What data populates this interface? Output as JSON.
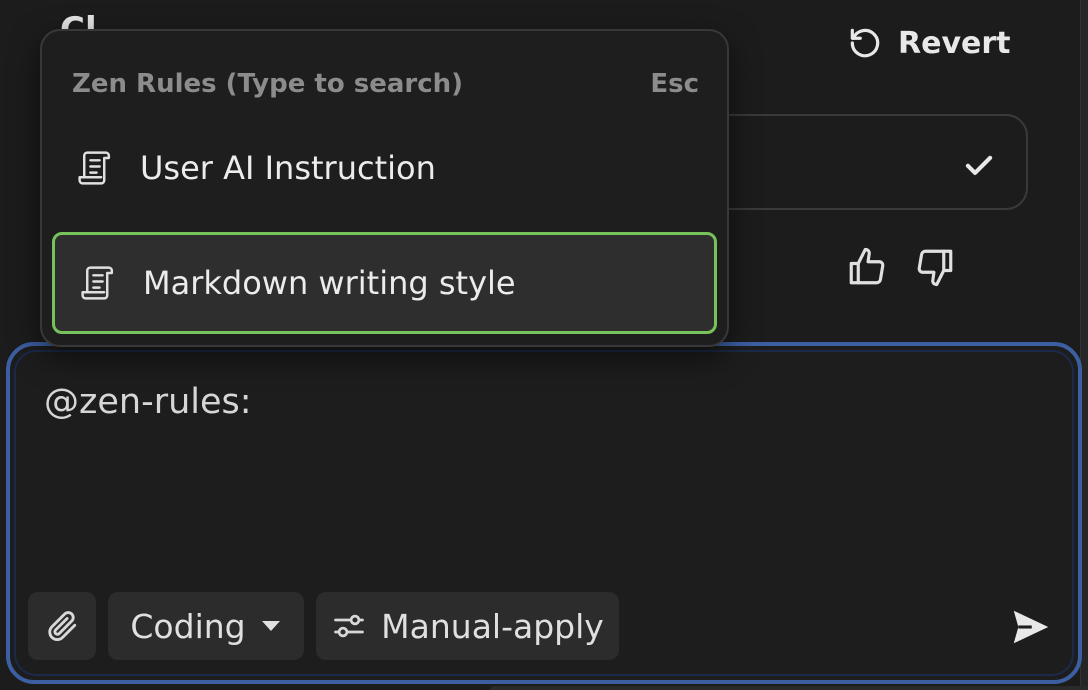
{
  "background_heading": "Cl",
  "header": {
    "revert_label": "Revert",
    "revert_icon": "undo-icon"
  },
  "background_field": {
    "confirm_icon": "check-icon"
  },
  "feedback": {
    "like_icon": "thumbs-up-icon",
    "dislike_icon": "thumbs-down-icon"
  },
  "rules_dropdown": {
    "header": "Zen Rules (Type to search)",
    "dismiss_hint": "Esc",
    "items": [
      {
        "label": "User AI Instruction",
        "icon": "scroll-icon",
        "selected": false
      },
      {
        "label": "Markdown writing style",
        "icon": "scroll-icon",
        "selected": true
      }
    ]
  },
  "composer": {
    "value": "@zen-rules:",
    "attach_icon": "paperclip-icon",
    "mode": {
      "label": "Coding",
      "icon": "caret-down-icon"
    },
    "apply": {
      "label": "Manual-apply",
      "icon": "sliders-icon"
    },
    "send_icon": "send-icon"
  },
  "colors": {
    "background": "#1c1c1c",
    "selected_border": "#78c25b",
    "composer_focus_border": "#3c5fa2",
    "muted_text": "#8c8c8c"
  }
}
